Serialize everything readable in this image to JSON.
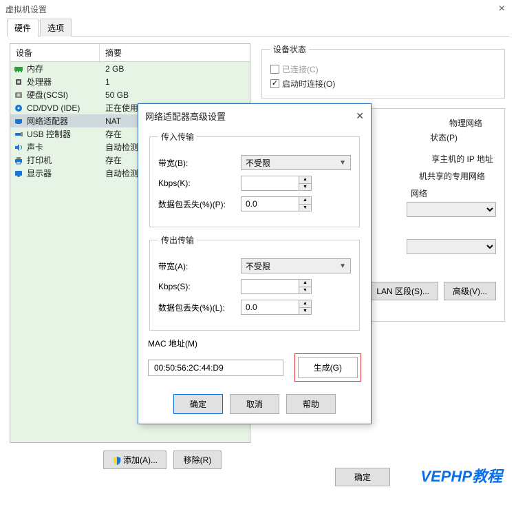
{
  "window_title": "虚拟机设置",
  "tabs": {
    "hardware": "硬件",
    "options": "选项"
  },
  "hw_header": {
    "device": "设备",
    "summary": "摘要"
  },
  "hw_rows": [
    {
      "icon": "memory-icon",
      "label": "内存",
      "summary": "2 GB"
    },
    {
      "icon": "cpu-icon",
      "label": "处理器",
      "summary": "1"
    },
    {
      "icon": "disk-icon",
      "label": "硬盘(SCSI)",
      "summary": "50 GB"
    },
    {
      "icon": "cd-icon",
      "label": "CD/DVD (IDE)",
      "summary": "正在使用"
    },
    {
      "icon": "nic-icon",
      "label": "网络适配器",
      "summary": "NAT"
    },
    {
      "icon": "usb-icon",
      "label": "USB 控制器",
      "summary": "存在"
    },
    {
      "icon": "sound-icon",
      "label": "声卡",
      "summary": "自动检测"
    },
    {
      "icon": "printer-icon",
      "label": "打印机",
      "summary": "存在"
    },
    {
      "icon": "display-icon",
      "label": "显示器",
      "summary": "自动检测"
    }
  ],
  "bottom": {
    "add": "添加(A)...",
    "remove": "移除(R)",
    "ok": "确定"
  },
  "right": {
    "status_legend": "设备状态",
    "connected": "已连接(C)",
    "connect_on": "启动时连接(O)",
    "phys_net": "物理网络",
    "state_p": "状态(P)",
    "share_ip": "享主机的 IP 地址",
    "private_net": "机共享的专用网络",
    "network_word": "网络",
    "lan_seg": "LAN 区段(S)...",
    "advanced": "高级(V)..."
  },
  "dialog": {
    "title": "网络适配器高级设置",
    "incoming_legend": "传入传输",
    "outgoing_legend": "传出传输",
    "bw_b": "带宽(B):",
    "bw_a": "带宽(A):",
    "kbps_k": "Kbps(K):",
    "kbps_s": "Kbps(S):",
    "loss_p": "数据包丢失(%)(P):",
    "loss_l": "数据包丢失(%)(L):",
    "unrestricted": "不受限",
    "loss_value": "0.0",
    "kbps_value": "",
    "mac_label": "MAC 地址(M)",
    "mac_value": "00:50:56:2C:44:D9",
    "generate": "生成(G)",
    "ok": "确定",
    "cancel": "取消",
    "help": "帮助"
  },
  "watermark": "VEPHP教程"
}
